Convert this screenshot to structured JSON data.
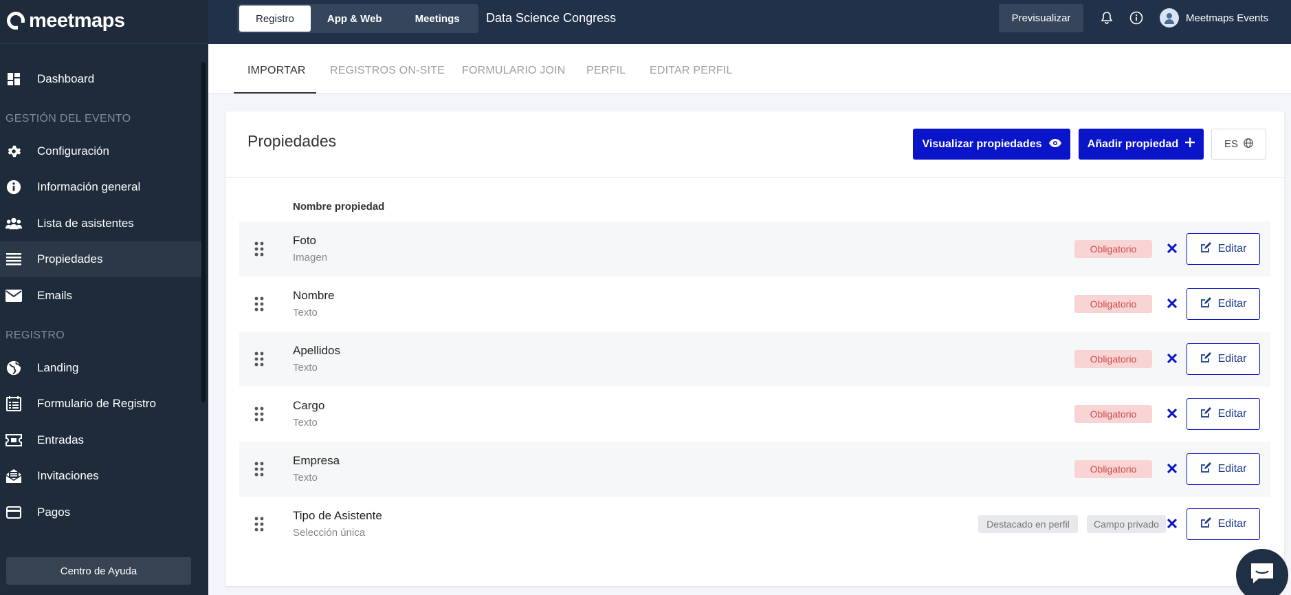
{
  "brand": {
    "logo_text": "meetmaps"
  },
  "sidebar": {
    "dashboard": "Dashboard",
    "section_event": "GESTIÓN DEL EVENTO",
    "event_items": [
      "Configuración",
      "Información general",
      "Lista de asistentes",
      "Propiedades",
      "Emails"
    ],
    "section_registro": "REGISTRO",
    "registro_items": [
      "Landing",
      "Formulario de Registro",
      "Entradas",
      "Invitaciones",
      "Pagos"
    ],
    "help_button": "Centro de Ayuda",
    "active_item": "Propiedades"
  },
  "topbar": {
    "segments": [
      "Registro",
      "App & Web",
      "Meetings"
    ],
    "active_segment": "Registro",
    "event_name": "Data Science Congress",
    "preview_label": "Previsualizar",
    "user_name": "Meetmaps Events"
  },
  "tabs": [
    "IMPORTAR",
    "REGISTROS ON-SITE",
    "FORMULARIO JOIN",
    "PERFIL",
    "EDITAR PERFIL"
  ],
  "active_tab": "IMPORTAR",
  "card": {
    "title": "Propiedades",
    "view_button": "Visualizar propiedades",
    "add_button": "Añadir propiedad",
    "language": "ES",
    "column_header": "Nombre propiedad"
  },
  "properties": [
    {
      "name": "Foto",
      "type": "Imagen",
      "badges": [
        "Obligatorio"
      ]
    },
    {
      "name": "Nombre",
      "type": "Texto",
      "badges": [
        "Obligatorio"
      ]
    },
    {
      "name": "Apellidos",
      "type": "Texto",
      "badges": [
        "Obligatorio"
      ]
    },
    {
      "name": "Cargo",
      "type": "Texto",
      "badges": [
        "Obligatorio"
      ]
    },
    {
      "name": "Empresa",
      "type": "Texto",
      "badges": [
        "Obligatorio"
      ]
    },
    {
      "name": "Tipo de Asistente",
      "type": "Selección única",
      "badges": [
        "Destacado en perfil",
        "Campo privado"
      ]
    }
  ],
  "edit_label": "Editar",
  "colors": {
    "sidebar_bg": "#1d2b3a",
    "topbar_bg": "#213149",
    "primary": "#0a14c8",
    "required_bg": "#f8d4d4",
    "required_text": "#d04a4a"
  }
}
